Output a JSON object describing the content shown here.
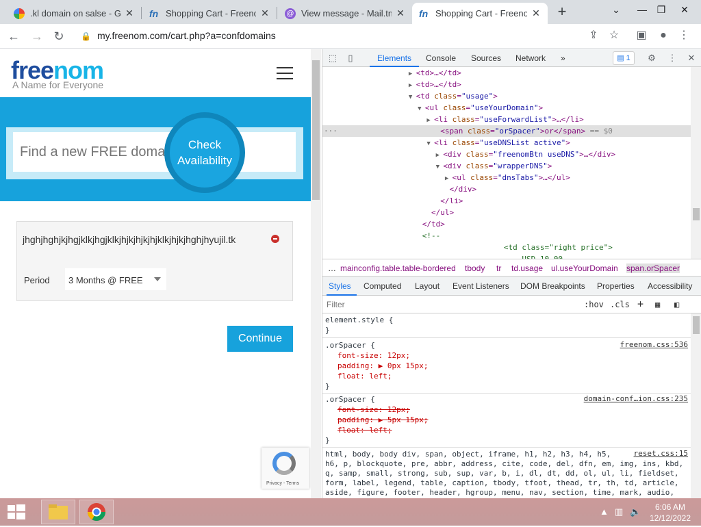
{
  "browser": {
    "tabs": [
      {
        "title": ".kl domain on salse - Goo",
        "icon": "google-icon",
        "active": false
      },
      {
        "title": "Shopping Cart - Freenom",
        "icon": "freenom-icon",
        "active": false
      },
      {
        "title": "View message - Mail.tm",
        "icon": "mailtm-icon",
        "active": false
      },
      {
        "title": "Shopping Cart - Freenom",
        "icon": "freenom-icon",
        "active": true
      }
    ],
    "new_tab_symbol": "+",
    "url": "my.freenom.com/cart.php?a=confdomains"
  },
  "site": {
    "logo_part1": "free",
    "logo_part2": "nom",
    "tagline": "A Name for Everyone",
    "search_placeholder": "Find a new FREE domain",
    "check_label_1": "Check",
    "check_label_2": "Availability",
    "domain": "jhghjhghjkjhgjklkjhgjklkjhjkjhjkjhjklkjhjkjhghjhyujil.tk",
    "period_label": "Period",
    "period_value": "3 Months @ FREE",
    "continue_label": "Continue",
    "recaptcha_text": "Privacy - Terms"
  },
  "devtools": {
    "tabs": [
      "Elements",
      "Console",
      "Sources",
      "Network"
    ],
    "more": "»",
    "message_count": "1",
    "dom_lines": [
      {
        "indent": 19,
        "arrow": "▶",
        "tag": "<td>…</td>",
        "sel": false
      },
      {
        "indent": 19,
        "arrow": "▶",
        "tag": "<td>…</td>",
        "sel": false
      },
      {
        "indent": 19,
        "arrow": "▼",
        "open": "<td ",
        "attr": "class",
        "val": "\"usage\"",
        "close": ">",
        "sel": false
      },
      {
        "indent": 21,
        "arrow": "▼",
        "open": "<ul ",
        "attr": "class",
        "val": "\"useYourDomain\"",
        "close": ">",
        "sel": false
      },
      {
        "indent": 23,
        "arrow": "▶",
        "open": "<li ",
        "attr": "class",
        "val": "\"useForwardList\"",
        "close": ">…</li>",
        "sel": false
      },
      {
        "indent": 24,
        "arrow": "",
        "open": "<span ",
        "attr": "class",
        "val": "\"orSpacer\"",
        "close": ">or</span>",
        "extra": " == $0",
        "sel": true
      },
      {
        "indent": 23,
        "arrow": "▼",
        "open": "<li ",
        "attr": "class",
        "val": "\"useDNSList active\"",
        "close": ">",
        "sel": false
      },
      {
        "indent": 25,
        "arrow": "▶",
        "open": "<div ",
        "attr": "class",
        "val": "\"freenomBtn useDNS\"",
        "close": ">…</div>",
        "sel": false
      },
      {
        "indent": 25,
        "arrow": "▼",
        "open": "<div ",
        "attr": "class",
        "val": "\"wrapperDNS\"",
        "close": ">",
        "sel": false
      },
      {
        "indent": 27,
        "arrow": "▶",
        "open": "<ul ",
        "attr": "class",
        "val": "\"dnsTabs\"",
        "close": ">…</ul>",
        "sel": false
      },
      {
        "indent": 26,
        "arrow": "",
        "tag": "</div>",
        "sel": false
      },
      {
        "indent": 24,
        "arrow": "",
        "tag": "</li>",
        "sel": false
      },
      {
        "indent": 22,
        "arrow": "",
        "tag": "</ul>",
        "sel": false
      },
      {
        "indent": 20,
        "arrow": "",
        "tag": "</td>",
        "sel": false
      },
      {
        "indent": 20,
        "arrow": "",
        "comment": "<!--",
        "sel": false
      },
      {
        "indent": 38,
        "arrow": "",
        "comment": "<td class=\"right price\">",
        "sel": false
      },
      {
        "indent": 42,
        "arrow": "",
        "comment": "USD 10.00",
        "sel": false
      }
    ],
    "breadcrumbs": [
      "…",
      "mainconfig.table.table-bordered",
      "tbody",
      "tr",
      "td.usage",
      "ul.useYourDomain",
      "span.orSpacer"
    ],
    "style_tabs": [
      "Styles",
      "Computed",
      "Layout",
      "Event Listeners",
      "DOM Breakpoints",
      "Properties",
      "Accessibility"
    ],
    "filter_placeholder": "Filter",
    "hov": ":hov",
    "cls": ".cls",
    "plus": "+",
    "rules": {
      "element_style": "element.style {",
      "close_brace": "}",
      "r1_selector": ".orSpacer {",
      "r1_source": "freenom.css:536",
      "r1_p1": "font-size: 12px;",
      "r1_p2": "padding: ▶ 0px 15px;",
      "r1_p3": "float: left;",
      "r2_selector": ".orSpacer {",
      "r2_source": "domain-conf…ion.css:235",
      "r2_p1": "font-size: 12px;",
      "r2_p2": "padding: ▶ 5px 15px;",
      "r2_p3": "float: left;",
      "r3_source": "reset.css:15",
      "r3_lines": [
        "html, body, body div, span, object, iframe, h1, h2, h3, h4, h5,",
        "h6, p, blockquote, pre, abbr, address, cite, code, del, dfn, em, img, ins, kbd,",
        "q, samp, small, strong, sub, sup, var, b, i, dl, dt, dd, ol, ul, li, fieldset,",
        "form, label, legend, table, caption, tbody, tfoot, thead, tr, th, td, article,",
        "aside, figure, footer, header, hgroup, menu, nav, section, time, mark, audio,"
      ]
    }
  },
  "taskbar": {
    "time": "6:06 AM",
    "date": "12/12/2022"
  },
  "colors": {
    "freenom_blue": "#17a2dc",
    "logo_dark": "#1e4d9e",
    "remove_red": "#c9302c"
  }
}
